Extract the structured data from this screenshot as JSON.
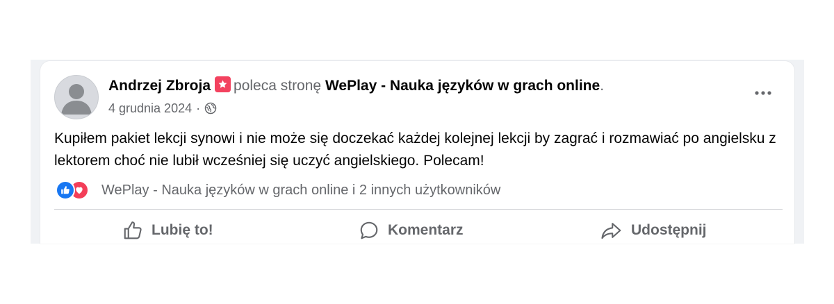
{
  "post": {
    "author": "Andrzej Zbroja",
    "action_text": "poleca stronę",
    "page_name": "WePlay - Nauka języków w grach online",
    "end_punct": ".",
    "date": "4 grudnia 2024",
    "separator": "·",
    "audience_icon": "globe-icon",
    "recommend_icon": "star-badge-icon",
    "body": "Kupiłem pakiet lekcji synowi i nie może się doczekać każdej kolejnej lekcji by zagrać i rozmawiać po angielsku z lektorem choć nie lubił wcześniej się uczyć angielskiego. Polecam!"
  },
  "reactions": {
    "icons": [
      "like-reaction-icon",
      "love-reaction-icon"
    ],
    "summary": "WePlay - Nauka języków w grach online i 2 innych użytkowników"
  },
  "actions": {
    "like": "Lubię to!",
    "comment": "Komentarz",
    "share": "Udostępnij"
  },
  "colors": {
    "like_blue": "#1877f2",
    "love_red": "#f33e58",
    "recommend_badge": "#f3425f",
    "secondary_text": "#65676b",
    "primary_text": "#050505",
    "background": "#f0f2f5"
  }
}
